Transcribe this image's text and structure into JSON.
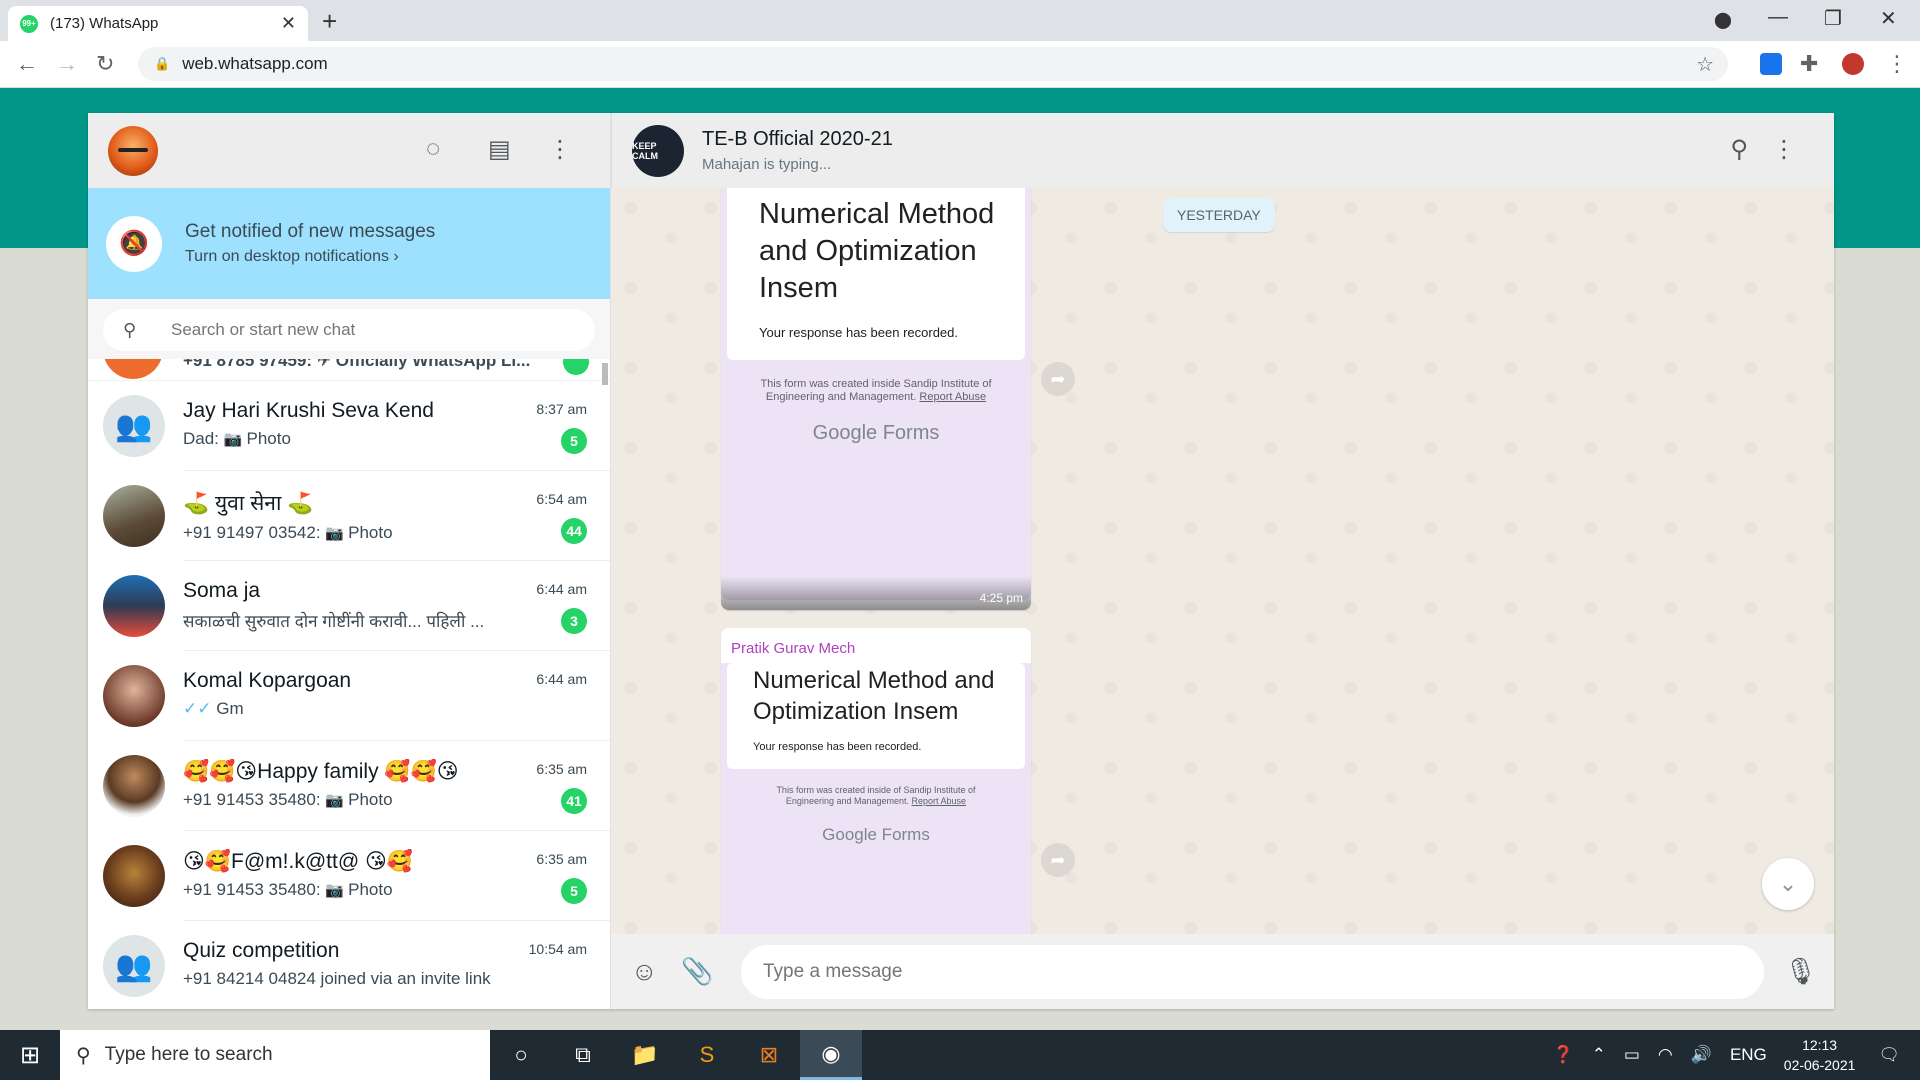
{
  "browser": {
    "tab_title": "(173) WhatsApp",
    "tab_badge": "99+",
    "url": "web.whatsapp.com"
  },
  "banner": {
    "title": "Get notified of new messages",
    "link": "Turn on desktop notifications ›"
  },
  "search": {
    "placeholder": "Search or start new chat"
  },
  "partial_chat": {
    "text": "+91 8785 97459: ✈ Officially WhatsApp Li..."
  },
  "chats": [
    {
      "name": "Jay Hari Krushi Seva Kend",
      "preview_prefix": "Dad: ",
      "preview": "Photo",
      "time": "8:37 am",
      "unread": "5"
    },
    {
      "name": "⛳ युवा सेना ⛳",
      "preview_prefix": "+91 91497 03542: ",
      "preview": "Photo",
      "time": "6:54 am",
      "unread": "44"
    },
    {
      "name": "Soma ja",
      "preview_prefix": "",
      "preview": "सकाळची सुरुवात दोन गोष्टींनी करावी... पहिली ...",
      "time": "6:44 am",
      "unread": "3"
    },
    {
      "name": "Komal Kopargoan",
      "preview_prefix": "✓✓ ",
      "preview": "Gm",
      "time": "6:44 am",
      "unread": ""
    },
    {
      "name": "🥰🥰😘Happy family 🥰🥰😘",
      "preview_prefix": "+91 91453 35480: ",
      "preview": "Photo",
      "time": "6:35 am",
      "unread": "41"
    },
    {
      "name": "😘🥰F@m!.k@tt@ 😘🥰",
      "preview_prefix": "+91 91453 35480: ",
      "preview": "Photo",
      "time": "6:35 am",
      "unread": "5"
    },
    {
      "name": "Quiz competition",
      "preview_prefix": "",
      "preview": "+91 84214 04824 joined via an invite link",
      "time": "10:54 am",
      "unread": ""
    }
  ],
  "conversation": {
    "group_name": "TE-B Official 2020-21",
    "status": "Mahajan is typing...",
    "avatar_text": "KEEP CALM",
    "day_chip": "YESTERDAY",
    "msg1": {
      "form_title": "Numerical Method and Optimization Insem",
      "response": "Your response has been recorded.",
      "footer": "This form was created inside Sandip Institute of Engineering and Management.",
      "report": "Report Abuse",
      "brand": "Google Forms",
      "time": "4:25 pm"
    },
    "msg2": {
      "sender": "Pratik Gurav Mech",
      "form_title": "Numerical Method and Optimization Insem",
      "response": "Your response has been recorded.",
      "footer": "This form was created inside of Sandip Institute of Engineering and Management.",
      "report": "Report Abuse",
      "brand": "Google Forms"
    },
    "composer_placeholder": "Type a message"
  },
  "taskbar": {
    "search_placeholder": "Type here to search",
    "language": "ENG",
    "time": "12:13",
    "date": "02-06-2021"
  },
  "colors": {
    "accent": "#009688",
    "unread_badge": "#25d366",
    "banner": "#9de1fe"
  }
}
